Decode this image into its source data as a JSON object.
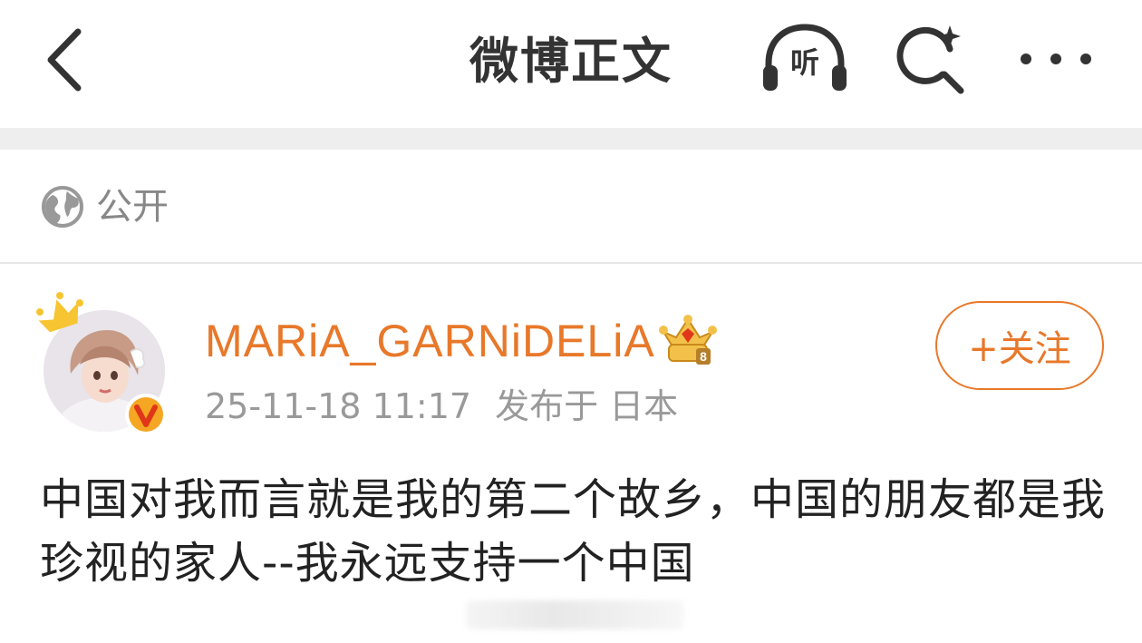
{
  "header": {
    "title": "微博正文",
    "listen_label": "听"
  },
  "visibility": {
    "label": "公开"
  },
  "post": {
    "author": "MARiA_GARNiDELiA",
    "timestamp": "25-11-18 11:17",
    "location": "发布于 日本",
    "follow_label": "+关注",
    "text": "中国对我而言就是我的第二个故乡，中国的朋友都是我珍视的家人--我永远支持一个中国"
  },
  "colors": {
    "accent": "#e8782a",
    "verified": "#f5a623",
    "text_primary": "#222222",
    "text_muted": "#999999"
  },
  "icons": {
    "back": "chevron-left-icon",
    "listen": "headphones-icon",
    "search": "search-sparkle-icon",
    "more": "more-dots-icon",
    "visibility": "globe-icon",
    "crown": "crown-icon",
    "verified": "verified-v-icon",
    "member": "member-crown-badge-icon"
  }
}
